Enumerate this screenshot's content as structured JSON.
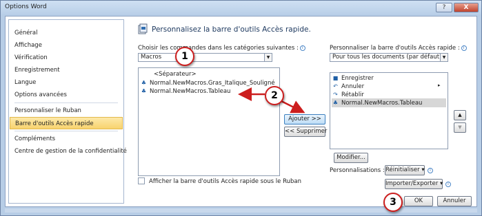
{
  "window": {
    "title": "Options Word",
    "help_icon": "?",
    "close_icon": "X"
  },
  "nav": {
    "items": [
      "Général",
      "Affichage",
      "Vérification",
      "Enregistrement",
      "Langue",
      "Options avancées",
      "Personnaliser le Ruban",
      "Barre d'outils Accès rapide",
      "Compléments",
      "Centre de gestion de la confidentialité"
    ],
    "selected": "Barre d'outils Accès rapide"
  },
  "main": {
    "header": "Personnalisez la barre d'outils Accès rapide.",
    "choose_label": "Choisir les commandes dans les catégories suivantes :",
    "choose_value": "Macros",
    "customize_label": "Personnaliser la barre d'outils Accès rapide :",
    "customize_value": "Pour tous les documents (par défaut)",
    "left_list": [
      "<Séparateur>",
      "Normal.NewMacros.Gras_Italique_Souligné",
      "Normal.NewMacros.Tableau"
    ],
    "right_list": [
      "Enregistrer",
      "Annuler",
      "Rétablir",
      "Normal.NewMacros.Tableau"
    ],
    "add_button": "Ajouter >>",
    "remove_button": "<< Supprimer",
    "modify_button": "Modifier...",
    "customizations_label": "Personnalisations :",
    "reset_button": "Réinitialiser",
    "import_export_button": "Importer/Exporter",
    "checkbox_label": "Afficher la barre d'outils Accès rapide sous le Ruban",
    "checkbox_checked": false,
    "ok_button": "OK",
    "cancel_button": "Annuler",
    "up_arrow": "▲",
    "down_arrow": "▼"
  },
  "callouts": [
    "1",
    "2",
    "3"
  ],
  "colors": {
    "accent": "#cc1e1e",
    "selected_nav": "#f8d36e"
  }
}
